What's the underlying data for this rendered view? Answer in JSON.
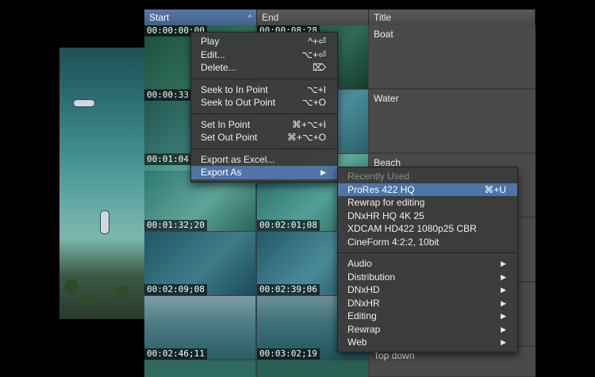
{
  "columns": {
    "start": "Start",
    "end": "End",
    "title": "Title",
    "sort_indicator": "^"
  },
  "rows": [
    {
      "start_tc": "00:00:00;00",
      "end_tc": "00:00:08;28",
      "title": "Boat"
    },
    {
      "start_tc": "00:00:33;",
      "end_tc": "",
      "title": "Water"
    },
    {
      "start_tc": "00:01:04;",
      "end_tc": "",
      "title": "Beach"
    },
    {
      "start_tc": "00:01:32;20",
      "end_tc": "00:02:01;08",
      "title": ""
    },
    {
      "start_tc": "00:02:09;08",
      "end_tc": "00:02:39;06",
      "title": ""
    },
    {
      "start_tc": "00:02:46;11",
      "end_tc": "00:03:02;19",
      "title": "Top down"
    }
  ],
  "context_menu": {
    "items": [
      {
        "label": "Play",
        "shortcut": "^+⏎"
      },
      {
        "label": "Edit...",
        "shortcut": "⌥+⏎"
      },
      {
        "label": "Delete...",
        "shortcut": "⌦"
      },
      {
        "label": "Seek to In Point",
        "shortcut": "⌥+I"
      },
      {
        "label": "Seek to Out Point",
        "shortcut": "⌥+O"
      },
      {
        "label": "Set In Point",
        "shortcut": "⌘+⌥+I"
      },
      {
        "label": "Set Out Point",
        "shortcut": "⌘+⌥+O"
      },
      {
        "label": "Export as Excel...",
        "shortcut": ""
      },
      {
        "label": "Export As",
        "shortcut": "▶"
      }
    ]
  },
  "submenu": {
    "header": "Recently Used",
    "recent": [
      {
        "label": "ProRes 422 HQ",
        "shortcut": "⌘+U"
      },
      {
        "label": "Rewrap for editing",
        "shortcut": ""
      },
      {
        "label": "DNxHR HQ 4K 25",
        "shortcut": ""
      },
      {
        "label": "XDCAM HD422 1080p25 CBR",
        "shortcut": ""
      },
      {
        "label": "CineForm 4:2:2, 10bit",
        "shortcut": ""
      }
    ],
    "categories": [
      "Audio",
      "Distribution",
      "DNxHD",
      "DNxHR",
      "Editing",
      "Rewrap",
      "Web"
    ],
    "arrow": "▶"
  },
  "colors": {
    "highlight": "#4e74a8",
    "header_selected": "#40608e",
    "menu_bg": "#3c3c3c"
  }
}
